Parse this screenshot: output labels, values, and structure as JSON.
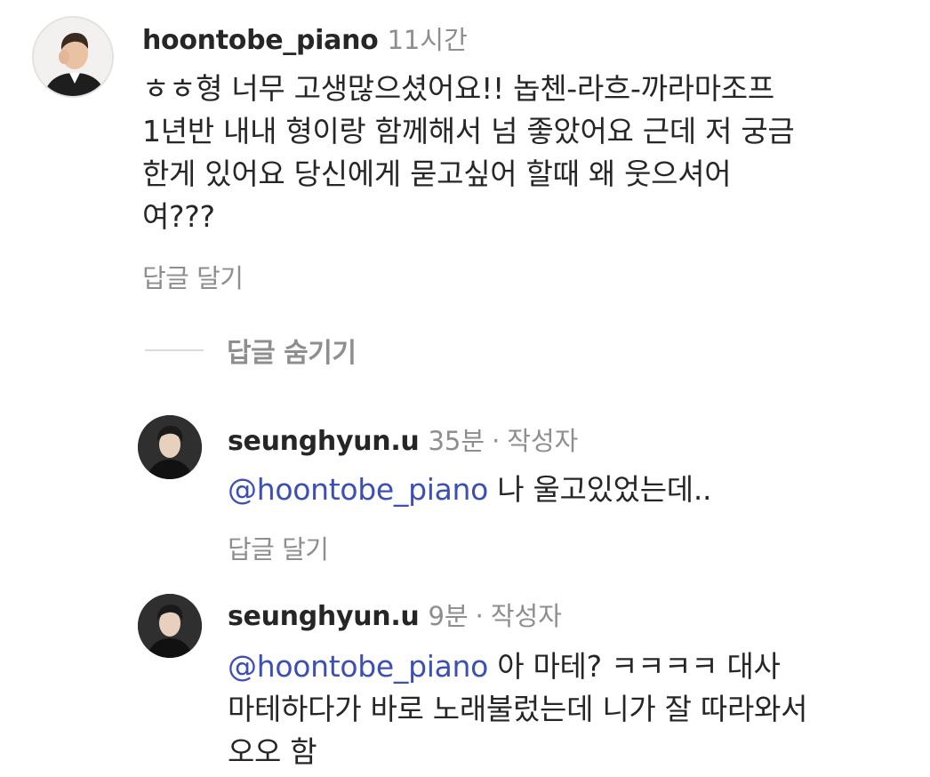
{
  "comment": {
    "username": "hoontobe_piano",
    "time": "11시간",
    "lines": [
      "ㅎㅎ형 너무 고생많으셨어요!! 놉첸-라흐-까라마조프",
      "1년반 내내 형이랑 함께해서 넘 좋았어요 근데 저 궁금",
      "한게 있어요 당신에게 묻고싶어 할때 왜 웃으셔어",
      "여???"
    ],
    "reply_label": "답글 달기"
  },
  "hide_replies_label": "답글 숨기기",
  "replies": [
    {
      "username": "seunghyun.u",
      "time": "35분",
      "separator": "·",
      "author_tag": "작성자",
      "mention": "@hoontobe_piano",
      "text_first": " 나 울고있었는데..",
      "lines": [],
      "reply_label": "답글 달기"
    },
    {
      "username": "seunghyun.u",
      "time": "9분",
      "separator": "·",
      "author_tag": "작성자",
      "mention": "@hoontobe_piano",
      "text_first": " 아 마테? ㅋㅋㅋㅋ 대사",
      "lines": [
        "마테하다가 바로 노래불렀는데 니가 잘 따라와서",
        "오오 함"
      ]
    }
  ]
}
